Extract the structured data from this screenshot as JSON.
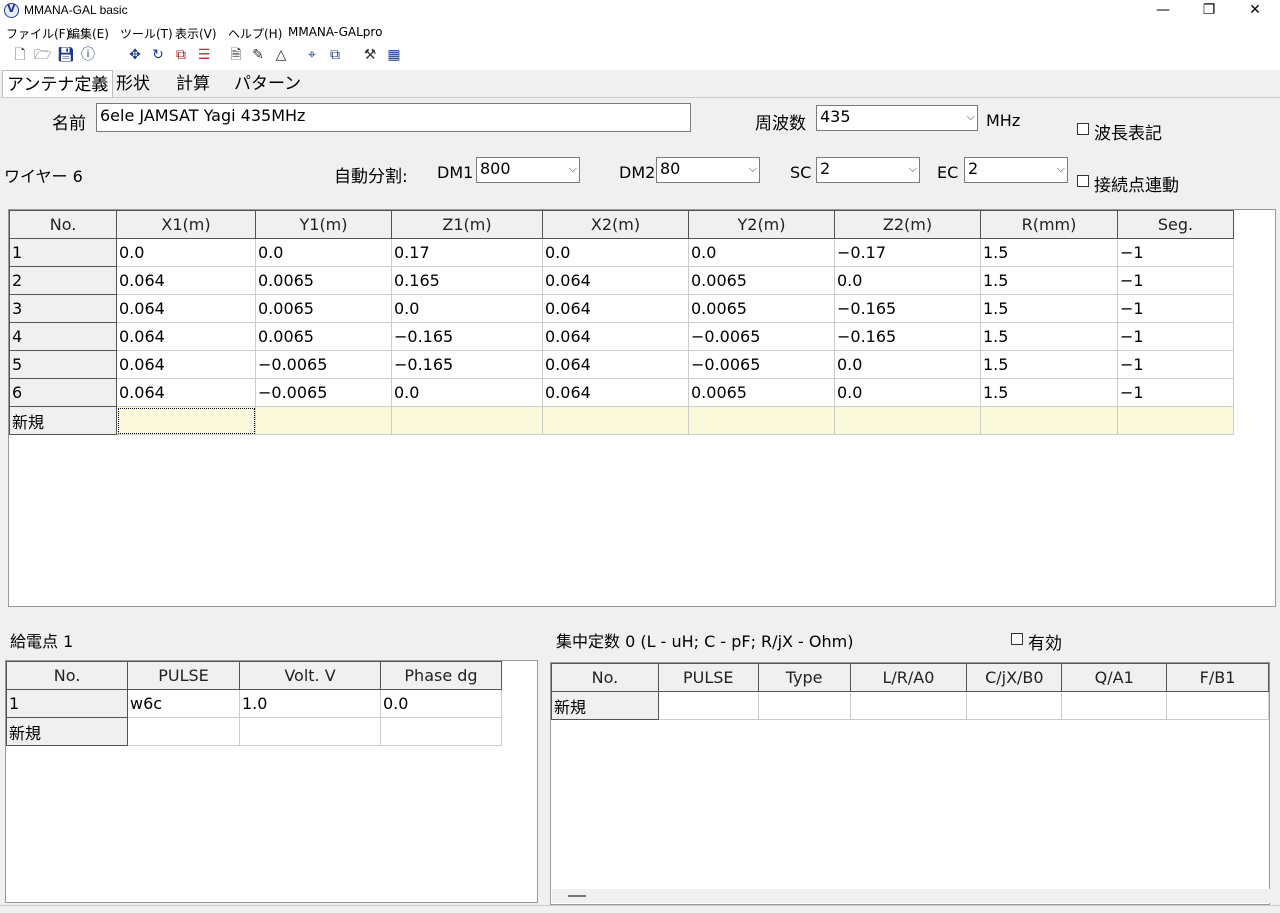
{
  "window": {
    "title": "MMANA-GAL basic",
    "minimize": "—",
    "restore": "❐",
    "close": "✕"
  },
  "menu": [
    "ファイル(F)",
    "編集(E)",
    "ツール(T)",
    "表示(V)",
    "ヘルプ(H)",
    "MMANA-GALpro"
  ],
  "toolbar": {
    "icons": [
      "new-file-icon",
      "open-folder-icon",
      "save-icon",
      "info-icon",
      "move-icon",
      "rotate-icon",
      "scale-icon",
      "wire-edit-icon",
      "document-icon",
      "pen-icon",
      "triangle-icon",
      "target-icon",
      "copy-icon",
      "tools-icon",
      "calculator-icon"
    ]
  },
  "tabs": [
    "アンテナ定義",
    "形状",
    "計算",
    "パターン"
  ],
  "antenna": {
    "name_label": "名前",
    "name_value": "6ele JAMSAT Yagi 435MHz",
    "freq_label": "周波数",
    "freq_value": "435",
    "freq_unit": "MHz",
    "wavelength_label": "波長表記",
    "wire_count_label": "ワイヤー 6",
    "auto_split_label": "自動分割:",
    "dm1_label": "DM1",
    "dm1_value": "800",
    "dm2_label": "DM2",
    "dm2_value": "80",
    "sc_label": "SC",
    "sc_value": "2",
    "ec_label": "EC",
    "ec_value": "2",
    "link_label": "接続点連動"
  },
  "wires": {
    "headers": [
      "No.",
      "X1(m)",
      "Y1(m)",
      "Z1(m)",
      "X2(m)",
      "Y2(m)",
      "Z2(m)",
      "R(mm)",
      "Seg."
    ],
    "rows": [
      [
        "1",
        "0.0",
        "0.0",
        "0.17",
        "0.0",
        "0.0",
        "−0.17",
        "1.5",
        "−1"
      ],
      [
        "2",
        "0.064",
        "0.0065",
        "0.165",
        "0.064",
        "0.0065",
        "0.0",
        "1.5",
        "−1"
      ],
      [
        "3",
        "0.064",
        "0.0065",
        "0.0",
        "0.064",
        "0.0065",
        "−0.165",
        "1.5",
        "−1"
      ],
      [
        "4",
        "0.064",
        "0.0065",
        "−0.165",
        "0.064",
        "−0.0065",
        "−0.165",
        "1.5",
        "−1"
      ],
      [
        "5",
        "0.064",
        "−0.0065",
        "−0.165",
        "0.064",
        "−0.0065",
        "0.0",
        "1.5",
        "−1"
      ],
      [
        "6",
        "0.064",
        "−0.0065",
        "0.0",
        "0.064",
        "0.0065",
        "0.0",
        "1.5",
        "−1"
      ]
    ],
    "new_row_label": "新規"
  },
  "feed": {
    "title": "給電点 1",
    "headers": [
      "No.",
      "PULSE",
      "Volt. V",
      "Phase dg"
    ],
    "rows": [
      [
        "1",
        "w6c",
        "1.0",
        "0.0"
      ]
    ],
    "new_row_label": "新規"
  },
  "loads": {
    "title": "集中定数 0 (L - uH; C - pF; R/jX - Ohm)",
    "enable_label": "有効",
    "headers": [
      "No.",
      "PULSE",
      "Type",
      "L/R/A0",
      "C/jX/B0",
      "Q/A1",
      "F/B1"
    ],
    "new_row_label": "新規"
  }
}
